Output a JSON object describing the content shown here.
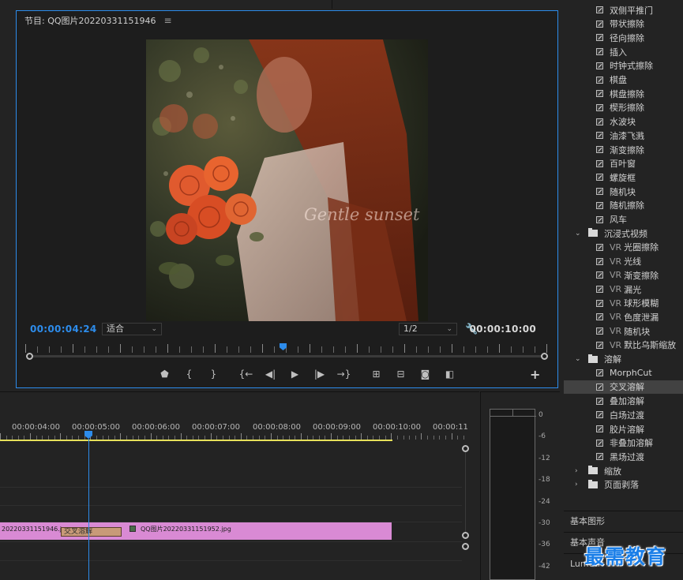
{
  "monitor": {
    "title": "节目: QQ图片20220331151946",
    "menu_icon": "hamburger-icon",
    "current_timecode": "00:00:04:24",
    "duration_timecode": "00:00:10:00",
    "fit_label": "适合",
    "resolution_label": "1/2",
    "watermark_text": "Gentle sunset",
    "transport_icons": [
      "marker-icon",
      "mark-in-icon",
      "mark-out-icon",
      "go-to-in-icon",
      "step-back-icon",
      "play-icon",
      "step-forward-icon",
      "go-to-out-icon",
      "insert-icon",
      "overwrite-icon",
      "camera-icon",
      "compare-icon"
    ]
  },
  "effects": {
    "items": [
      {
        "label": "双侧平推门",
        "type": "item"
      },
      {
        "label": "带状擦除",
        "type": "item"
      },
      {
        "label": "径向擦除",
        "type": "item"
      },
      {
        "label": "插入",
        "type": "item"
      },
      {
        "label": "时钟式擦除",
        "type": "item"
      },
      {
        "label": "棋盘",
        "type": "item"
      },
      {
        "label": "棋盘擦除",
        "type": "item"
      },
      {
        "label": "楔形擦除",
        "type": "item"
      },
      {
        "label": "水波块",
        "type": "item"
      },
      {
        "label": "油漆飞溅",
        "type": "item"
      },
      {
        "label": "渐变擦除",
        "type": "item"
      },
      {
        "label": "百叶窗",
        "type": "item"
      },
      {
        "label": "螺旋框",
        "type": "item"
      },
      {
        "label": "随机块",
        "type": "item"
      },
      {
        "label": "随机擦除",
        "type": "item"
      },
      {
        "label": "风车",
        "type": "item"
      },
      {
        "label": "沉浸式视频",
        "type": "folder",
        "expanded": true
      },
      {
        "label": "光圈擦除",
        "type": "vr"
      },
      {
        "label": "光线",
        "type": "vr"
      },
      {
        "label": "渐变擦除",
        "type": "vr"
      },
      {
        "label": "漏光",
        "type": "vr"
      },
      {
        "label": "球形模糊",
        "type": "vr"
      },
      {
        "label": "色度泄漏",
        "type": "vr"
      },
      {
        "label": "随机块",
        "type": "vr"
      },
      {
        "label": "默比乌斯缩放",
        "type": "vr"
      },
      {
        "label": "溶解",
        "type": "folder",
        "expanded": true
      },
      {
        "label": "MorphCut",
        "type": "item"
      },
      {
        "label": "交叉溶解",
        "type": "item",
        "selected": true
      },
      {
        "label": "叠加溶解",
        "type": "item"
      },
      {
        "label": "白场过渡",
        "type": "item"
      },
      {
        "label": "胶片溶解",
        "type": "item"
      },
      {
        "label": "非叠加溶解",
        "type": "item"
      },
      {
        "label": "黑场过渡",
        "type": "item"
      },
      {
        "label": "缩放",
        "type": "folder",
        "expanded": false
      },
      {
        "label": "页面剥落",
        "type": "folder",
        "expanded": false
      }
    ],
    "vr_prefix": "VR"
  },
  "side_panels": {
    "basic_graphics": "基本图形",
    "basic_sound": "基本声音",
    "lumetri": "Lumetri"
  },
  "brand": "最需教育",
  "timeline": {
    "ruler_labels": [
      "00:00:04:00",
      "00:00:05:00",
      "00:00:06:00",
      "00:00:07:00",
      "00:00:08:00",
      "00:00:09:00",
      "00:00:10:00",
      "00:00:11"
    ],
    "clip_a_label": "20220331151946.jpg",
    "clip_b_label": "QQ图片20220331151952.jpg",
    "transition_label": "交叉溶解"
  },
  "meter": {
    "db_labels": [
      "0",
      "-6",
      "-12",
      "-18",
      "-24",
      "-30",
      "-36",
      "-42"
    ]
  },
  "colors": {
    "accent": "#2d8ceb",
    "clip": "#d98ad4",
    "transition": "#c89a78",
    "work_area": "#e6e05a"
  }
}
